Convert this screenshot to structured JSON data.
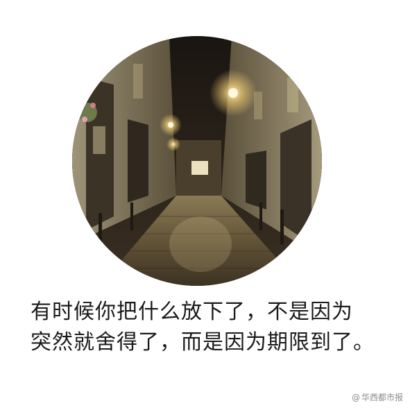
{
  "photo": {
    "subject": "night-cobblestone-alley-image"
  },
  "quote": {
    "line1": "有时候你把什么放下了，不是因为",
    "line2": "突然就舍得了，而是因为期限到了。"
  },
  "watermark": {
    "at": "@",
    "text": "华西都市报"
  },
  "colors": {
    "background": "#ffffff",
    "text": "#1a1a1a",
    "watermark": "#8a8a8a",
    "lamp": "#ffe9a8"
  }
}
